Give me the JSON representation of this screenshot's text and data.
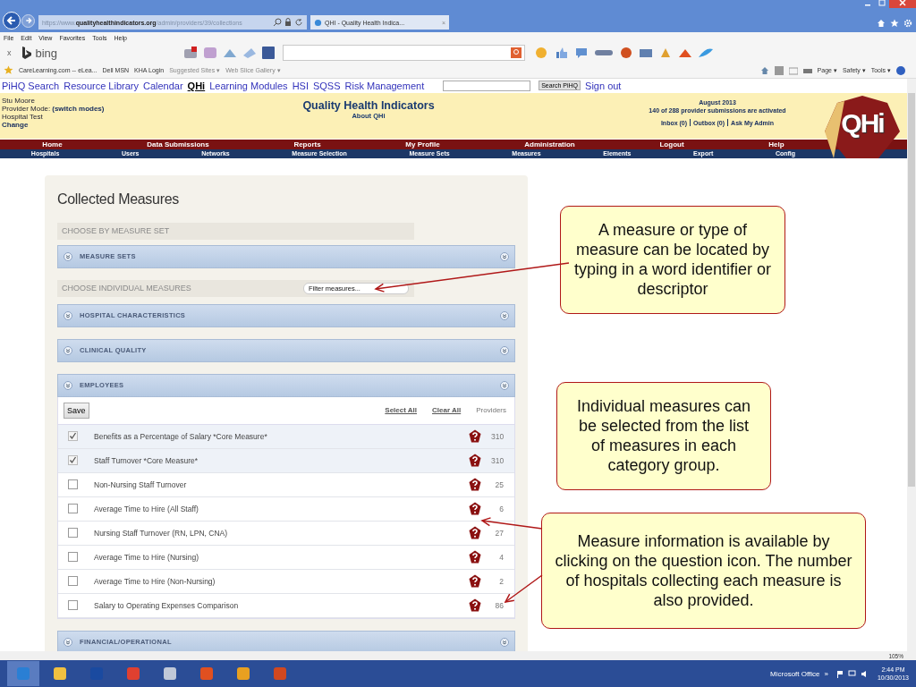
{
  "browser": {
    "url_host": "https://www.",
    "url_domain": "qualityhealthindicators.org",
    "url_path": "/admin/providers/39/collections",
    "tab_title": "QHI - Quality Health Indica...",
    "tab_close": "×",
    "menu": [
      "File",
      "Edit",
      "View",
      "Favorites",
      "Tools",
      "Help"
    ],
    "toolbar_close": "x",
    "toolbar_brand": "bing",
    "favorites": [
      "CareLearning.com -- eLea...",
      "Dell MSN",
      "KHA Login",
      "Suggested Sites ▾",
      "Web Slice Gallery ▾"
    ],
    "command_menus": [
      "Page ▾",
      "Safety ▾",
      "Tools ▾"
    ]
  },
  "site_nav": {
    "links": [
      {
        "label": "PiHQ Search",
        "selected": false
      },
      {
        "label": "Resource Library",
        "selected": false
      },
      {
        "label": "Calendar",
        "selected": false
      },
      {
        "label": "QHi",
        "selected": true
      },
      {
        "label": "Learning Modules",
        "selected": false
      },
      {
        "label": "HSI",
        "selected": false
      },
      {
        "label": "SQSS",
        "selected": false
      },
      {
        "label": "Risk Management",
        "selected": false
      }
    ],
    "search_button": "Search PiHQ",
    "sign_out": "Sign out"
  },
  "header": {
    "user": "Stu Moore",
    "mode_label": "Provider Mode:",
    "switch_modes": "(switch modes)",
    "hospital": "Hospital Test",
    "change": "Change",
    "title": "Quality Health Indicators",
    "about": "About QHi",
    "period": "August 2013",
    "activation": "140 of 288 provider submissions are activated",
    "links": [
      "Inbox (0)",
      "Outbox (0)",
      "Ask My Admin"
    ],
    "logo": "QHi"
  },
  "main_nav": [
    "Home",
    "Data Submissions",
    "Reports",
    "My Profile",
    "Administration",
    "Logout",
    "Help"
  ],
  "sub_nav": [
    "Hospitals",
    "Users",
    "Networks",
    "Measure Selection",
    "Measure Sets",
    "Measures",
    "Elements",
    "Export",
    "Config"
  ],
  "panel": {
    "title": "Collected Measures",
    "measure_set_heading": "CHOOSE BY MEASURE SET",
    "measure_set_categories": [
      {
        "label": "MEASURE SETS",
        "expanded": false
      }
    ],
    "individual_heading": "CHOOSE INDIVIDUAL MEASURES",
    "filter_placeholder": "Filter measures...",
    "categories": [
      {
        "label": "HOSPITAL CHARACTERISTICS",
        "expanded": false
      },
      {
        "label": "CLINICAL QUALITY",
        "expanded": false
      },
      {
        "label": "EMPLOYEES",
        "expanded": true,
        "save": "Save",
        "select_all": "Select All",
        "clear_all": "Clear All",
        "providers_header": "Providers",
        "measures": [
          {
            "name": "Benefits as a Percentage of Salary *Core Measure*",
            "checked": true,
            "providers": "310"
          },
          {
            "name": "Staff Turnover *Core Measure*",
            "checked": true,
            "providers": "310"
          },
          {
            "name": "Non-Nursing Staff Turnover",
            "checked": false,
            "providers": "25"
          },
          {
            "name": "Average Time to Hire (All Staff)",
            "checked": false,
            "providers": "6"
          },
          {
            "name": "Nursing Staff Turnover (RN, LPN, CNA)",
            "checked": false,
            "providers": "27"
          },
          {
            "name": "Average Time to Hire (Nursing)",
            "checked": false,
            "providers": "4"
          },
          {
            "name": "Average Time to Hire (Non-Nursing)",
            "checked": false,
            "providers": "2"
          },
          {
            "name": "Salary to Operating Expenses Comparison",
            "checked": false,
            "providers": "86"
          }
        ]
      },
      {
        "label": "FINANCIAL/OPERATIONAL",
        "expanded": false
      }
    ]
  },
  "callouts": [
    {
      "text": "A measure or type of measure can be located by typing in a word identifier or descriptor"
    },
    {
      "text": "Individual measures can be selected from the list of measures in each category group."
    },
    {
      "text": "Measure information is available by clicking on the question icon. The number of hospitals collecting each measure is also provided."
    }
  ],
  "status_bar": {
    "zoom": "105%"
  },
  "taskbar": {
    "tray_label": "Microsoft Office",
    "overflow": "»",
    "time": "2:44 PM",
    "date": "10/30/2013"
  }
}
